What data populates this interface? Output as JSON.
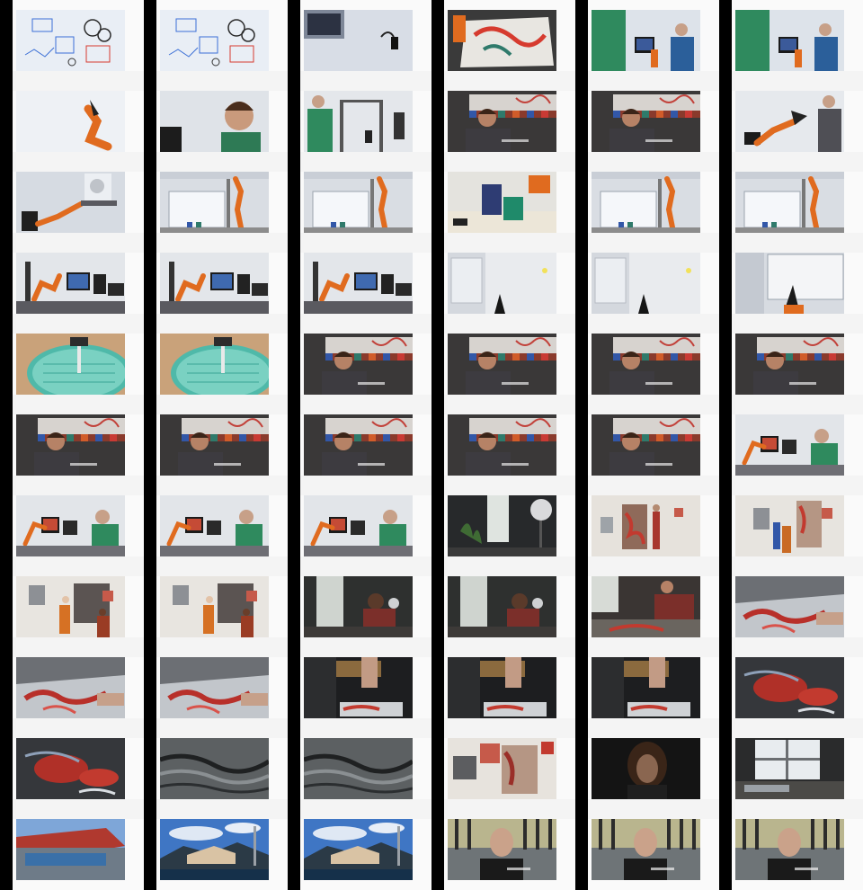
{
  "contact_sheet": {
    "columns": 6,
    "rows": 11,
    "frames": [
      [
        "whiteboard-sketch",
        "whiteboard-sketch",
        "wall-lamp",
        "robot-painting-canvas",
        "lab-team",
        "lab-team"
      ],
      [
        "robot-arm-closeup",
        "man-portrait",
        "lab-worker",
        "interview-man",
        "interview-man",
        "man-with-robot"
      ],
      [
        "robot-handshake",
        "robot-whiteboard",
        "robot-whiteboard",
        "paint-jars",
        "robot-whiteboard",
        "robot-whiteboard"
      ],
      [
        "robot-monitors",
        "robot-monitors",
        "robot-monitors",
        "white-room",
        "white-room",
        "robot-drawing"
      ],
      [
        "paint-dish-closeup",
        "paint-dish-closeup",
        "interview-man",
        "interview-man",
        "interview-man",
        "interview-man"
      ],
      [
        "interview-man",
        "interview-man",
        "interview-man",
        "interview-man",
        "interview-man",
        "man-at-desk"
      ],
      [
        "man-at-desk",
        "man-at-desk",
        "man-at-desk",
        "dark-room-lamp",
        "artist-painting",
        "two-painters"
      ],
      [
        "painters-wall",
        "painters-wall",
        "woman-studio",
        "woman-studio",
        "woman-working",
        "red-painting-table"
      ],
      [
        "red-painting-table",
        "red-painting-table",
        "hands-painting",
        "hands-painting",
        "hands-painting",
        "red-paint-closeup"
      ],
      [
        "red-paint-closeup",
        "gray-texture",
        "gray-texture",
        "studio-wall-art",
        "woman-dark",
        "studio-window"
      ],
      [
        "building-roof",
        "building-sky",
        "building-sky",
        "bald-man-interview",
        "bald-man-interview",
        "bald-man-interview"
      ]
    ]
  }
}
